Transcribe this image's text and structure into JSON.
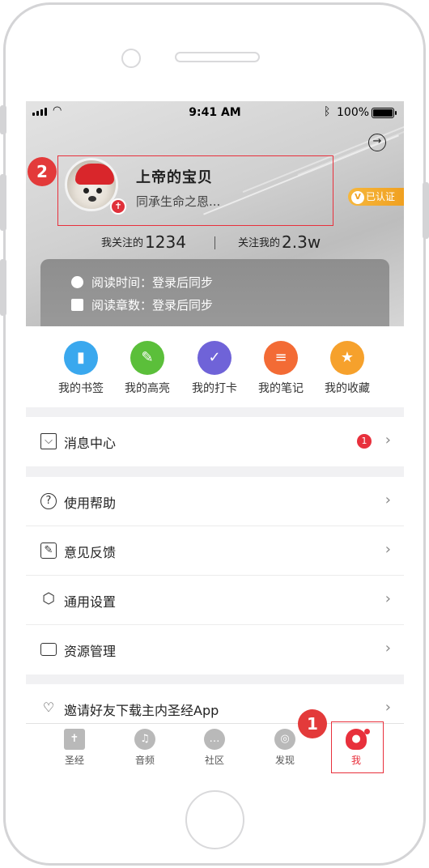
{
  "status_bar": {
    "time": "9:41 AM",
    "battery": "100%"
  },
  "profile": {
    "username": "上帝的宝贝",
    "signature": "同承生命之恩...",
    "verified_label": "已认证",
    "verified_mark": "V",
    "cross_mark": "✝"
  },
  "stats": {
    "following_label": "我关注的",
    "following_count": "1234",
    "followers_label": "关注我的",
    "followers_count": "2.3w"
  },
  "reading": {
    "time_line": "阅读时间：登录后同步",
    "chapters_line": "阅读章数：登录后同步"
  },
  "shortcuts": [
    {
      "label": "我的书签",
      "icon": "bookmark-icon",
      "color": "#3aa8ee"
    },
    {
      "label": "我的高亮",
      "icon": "highlight-pen-icon",
      "color": "#5bbf3a"
    },
    {
      "label": "我的打卡",
      "icon": "checkin-icon",
      "color": "#6f63d8"
    },
    {
      "label": "我的笔记",
      "icon": "note-icon",
      "color": "#f36b35"
    },
    {
      "label": "我的收藏",
      "icon": "favorite-icon",
      "color": "#f6a12c"
    }
  ],
  "menu": {
    "messages": {
      "label": "消息中心",
      "badge": "1"
    },
    "help": "使用帮助",
    "feedback": "意见反馈",
    "settings": "通用设置",
    "resources": "资源管理",
    "invite": "邀请好友下载主内圣经App"
  },
  "tabs": [
    {
      "label": "圣经",
      "icon": "bible-icon"
    },
    {
      "label": "音频",
      "icon": "headphones-icon"
    },
    {
      "label": "社区",
      "icon": "chat-bubbles-icon"
    },
    {
      "label": "发现",
      "icon": "compass-icon"
    },
    {
      "label": "我",
      "icon": "person-icon",
      "active": true
    }
  ],
  "annotations": {
    "one": "1",
    "two": "2"
  },
  "colors": {
    "accent": "#e8303c",
    "verified": "#f0a020"
  }
}
